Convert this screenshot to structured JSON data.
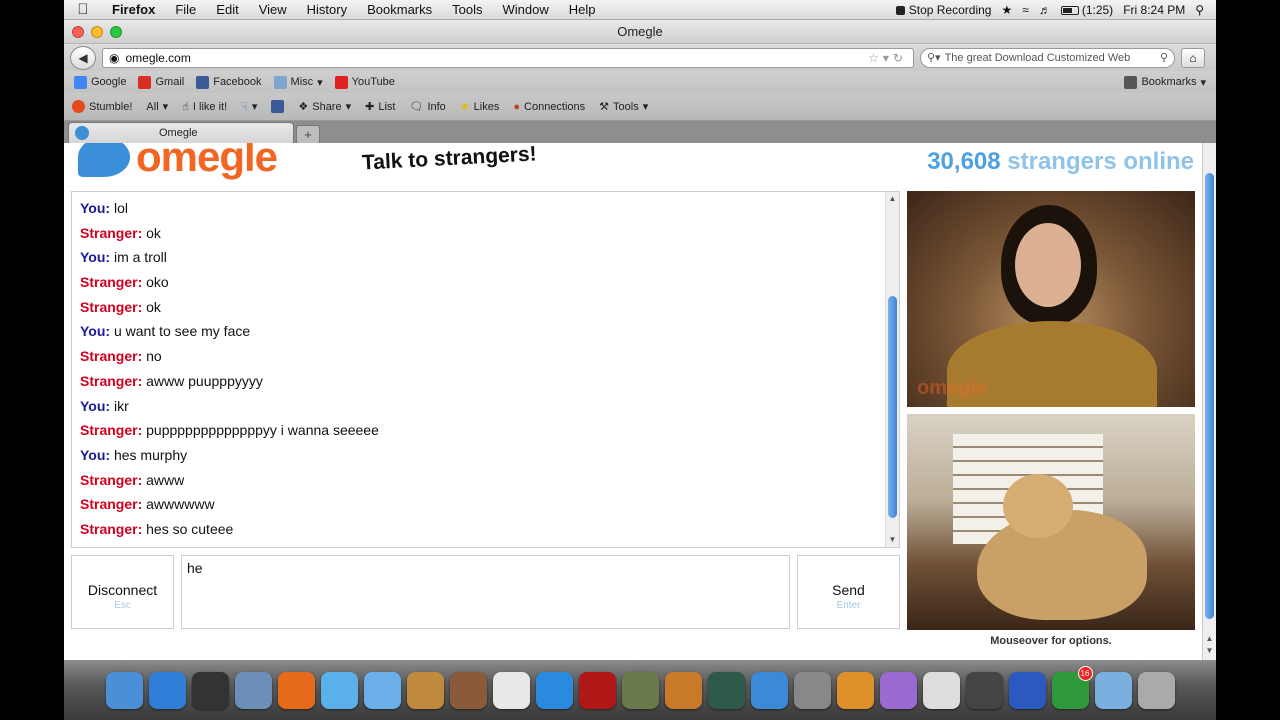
{
  "menubar": {
    "app": "Firefox",
    "items": [
      "File",
      "Edit",
      "View",
      "History",
      "Bookmarks",
      "Tools",
      "Window",
      "Help"
    ],
    "recording": "Stop Recording",
    "battery": "(1:25)",
    "clock": "Fri 8:24 PM"
  },
  "window": {
    "title": "Omegle"
  },
  "navbar": {
    "url": "omegle.com",
    "search_placeholder": "The great Download Customized Web"
  },
  "bookmarks": {
    "items": [
      {
        "label": "Google",
        "icon": "google-icon",
        "color": "#4285f4"
      },
      {
        "label": "Gmail",
        "icon": "gmail-icon",
        "color": "#d93025"
      },
      {
        "label": "Facebook",
        "icon": "facebook-icon",
        "color": "#3b5998"
      },
      {
        "label": "Misc",
        "icon": "folder-icon",
        "color": "#7fa6cf"
      },
      {
        "label": "YouTube",
        "icon": "youtube-icon",
        "color": "#e02020"
      }
    ],
    "right": "Bookmarks"
  },
  "stumble": {
    "items": [
      "Stumble!",
      "All",
      "I like it!",
      "Share",
      "List",
      "Info",
      "Likes",
      "Connections",
      "Tools"
    ]
  },
  "tab": {
    "label": "Omegle"
  },
  "page": {
    "logo": "omegle",
    "tagline": "Talk to strangers!",
    "online_count": "30,608",
    "online_label": "strangers online",
    "chat": [
      {
        "who": "You:",
        "text": "lol"
      },
      {
        "who": "Stranger:",
        "text": "ok"
      },
      {
        "who": "You:",
        "text": "im a troll"
      },
      {
        "who": "Stranger:",
        "text": "oko"
      },
      {
        "who": "Stranger:",
        "text": "ok"
      },
      {
        "who": "You:",
        "text": "u want to see my face"
      },
      {
        "who": "Stranger:",
        "text": "no"
      },
      {
        "who": "Stranger:",
        "text": "awww puupppyyyy"
      },
      {
        "who": "You:",
        "text": "ikr"
      },
      {
        "who": "Stranger:",
        "text": "pupppppppppppppyy i wanna seeeee"
      },
      {
        "who": "You:",
        "text": "hes murphy"
      },
      {
        "who": "Stranger:",
        "text": "awww"
      },
      {
        "who": "Stranger:",
        "text": "awwwwww"
      },
      {
        "who": "Stranger:",
        "text": "hes so cuteee"
      }
    ],
    "disconnect_label": "Disconnect",
    "disconnect_key": "Esc",
    "message_value": "he",
    "send_label": "Send",
    "send_key": "Enter",
    "video_watermark": "omegle",
    "mouseover": "Mouseover for options."
  },
  "dock": {
    "icons": [
      {
        "name": "finder-icon",
        "color": "#4a90d9"
      },
      {
        "name": "app-store-icon",
        "color": "#2f7fd8"
      },
      {
        "name": "dashboard-icon",
        "color": "#333333"
      },
      {
        "name": "preview-icon",
        "color": "#6b8fb8"
      },
      {
        "name": "firefox-icon",
        "color": "#e56a1c"
      },
      {
        "name": "word-icon",
        "color": "#5ab0e8"
      },
      {
        "name": "facetime-icon",
        "color": "#6aaeea"
      },
      {
        "name": "address-book-icon",
        "color": "#c08a3e"
      },
      {
        "name": "photo-booth-icon",
        "color": "#8a5a3a"
      },
      {
        "name": "calendar-icon",
        "color": "#e8e8e8"
      },
      {
        "name": "itunes-icon",
        "color": "#2a8ae0"
      },
      {
        "name": "movie-icon",
        "color": "#b01818"
      },
      {
        "name": "iphoto-icon",
        "color": "#6a7a4a"
      },
      {
        "name": "garageband-icon",
        "color": "#c87a2a"
      },
      {
        "name": "time-machine-icon",
        "color": "#2e5a4a"
      },
      {
        "name": "safari-icon",
        "color": "#3a8ad8"
      },
      {
        "name": "system-preferences-icon",
        "color": "#888888"
      },
      {
        "name": "pages-icon",
        "color": "#e0902a"
      },
      {
        "name": "emerald-icon",
        "color": "#9a6ad0"
      },
      {
        "name": "mask-icon",
        "color": "#dddddd"
      },
      {
        "name": "webcam-icon",
        "color": "#444444"
      },
      {
        "name": "quicktime-icon",
        "color": "#2a5ac0"
      },
      {
        "name": "spotify-icon",
        "color": "#2e9a3a",
        "badge": "16"
      },
      {
        "name": "documents-folder-icon",
        "color": "#7ab0e0"
      },
      {
        "name": "trash-icon",
        "color": "#aaaaaa"
      }
    ]
  }
}
